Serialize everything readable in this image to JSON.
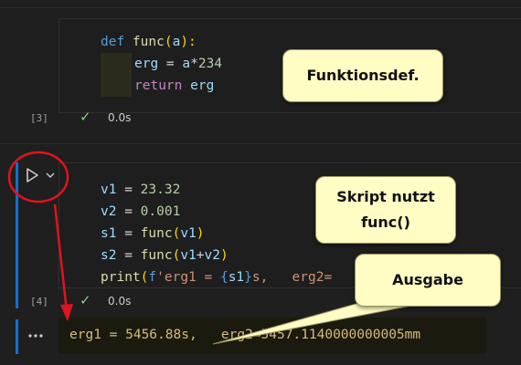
{
  "cells": [
    {
      "execution_count": "[3]",
      "status_time": "0.0s",
      "code_lines": [
        [
          {
            "t": "def ",
            "c": "kw-blue"
          },
          {
            "t": "func",
            "c": "fn"
          },
          {
            "t": "(",
            "c": "paren"
          },
          {
            "t": "a",
            "c": "var"
          },
          {
            "t": "):",
            "c": "paren"
          }
        ],
        [
          {
            "t": "erg",
            "c": "var"
          },
          {
            "t": " = ",
            "c": "op"
          },
          {
            "t": "a",
            "c": "var"
          },
          {
            "t": "*",
            "c": "op"
          },
          {
            "t": "234",
            "c": "num"
          }
        ],
        [
          {
            "t": "return ",
            "c": "kw-purple"
          },
          {
            "t": "erg",
            "c": "var"
          }
        ]
      ]
    },
    {
      "execution_count": "[4]",
      "status_time": "0.0s",
      "code_lines": [
        [
          {
            "t": "v1",
            "c": "var"
          },
          {
            "t": " = ",
            "c": "op"
          },
          {
            "t": "23.32",
            "c": "num"
          }
        ],
        [
          {
            "t": "v2",
            "c": "var"
          },
          {
            "t": " = ",
            "c": "op"
          },
          {
            "t": "0.001",
            "c": "num"
          }
        ],
        [
          {
            "t": "s1",
            "c": "var"
          },
          {
            "t": " = ",
            "c": "op"
          },
          {
            "t": "func",
            "c": "fn"
          },
          {
            "t": "(",
            "c": "paren"
          },
          {
            "t": "v1",
            "c": "var"
          },
          {
            "t": ")",
            "c": "paren"
          }
        ],
        [
          {
            "t": "s2",
            "c": "var"
          },
          {
            "t": " = ",
            "c": "op"
          },
          {
            "t": "func",
            "c": "fn"
          },
          {
            "t": "(",
            "c": "paren"
          },
          {
            "t": "v1",
            "c": "var"
          },
          {
            "t": "+",
            "c": "op"
          },
          {
            "t": "v2",
            "c": "var"
          },
          {
            "t": ")",
            "c": "paren"
          }
        ],
        [
          {
            "t": "print",
            "c": "fn"
          },
          {
            "t": "(",
            "c": "paren"
          },
          {
            "t": "f",
            "c": "kw-blue"
          },
          {
            "t": "'erg1 = ",
            "c": "str"
          },
          {
            "t": "{",
            "c": "brace"
          },
          {
            "t": "s1",
            "c": "var"
          },
          {
            "t": "}",
            "c": "brace"
          },
          {
            "t": "s,   erg2=",
            "c": "str"
          }
        ]
      ]
    }
  ],
  "output": {
    "text": "erg1 = 5456.88s,   erg2=5457.1140000000005mm"
  },
  "callouts": {
    "funktionsdef": "Funktionsdef.",
    "skript_line1": "Skript nutzt",
    "skript_line2": "func()",
    "ausgabe": "Ausgabe"
  },
  "icons": {
    "run": "play-icon",
    "chevron": "chevron-down-icon",
    "check": "check-icon",
    "more": "more-icon"
  },
  "colors": {
    "annotation_red": "#e0141e",
    "callout_bg": "#fffcc4",
    "cell_bar": "#0e6fd8"
  }
}
